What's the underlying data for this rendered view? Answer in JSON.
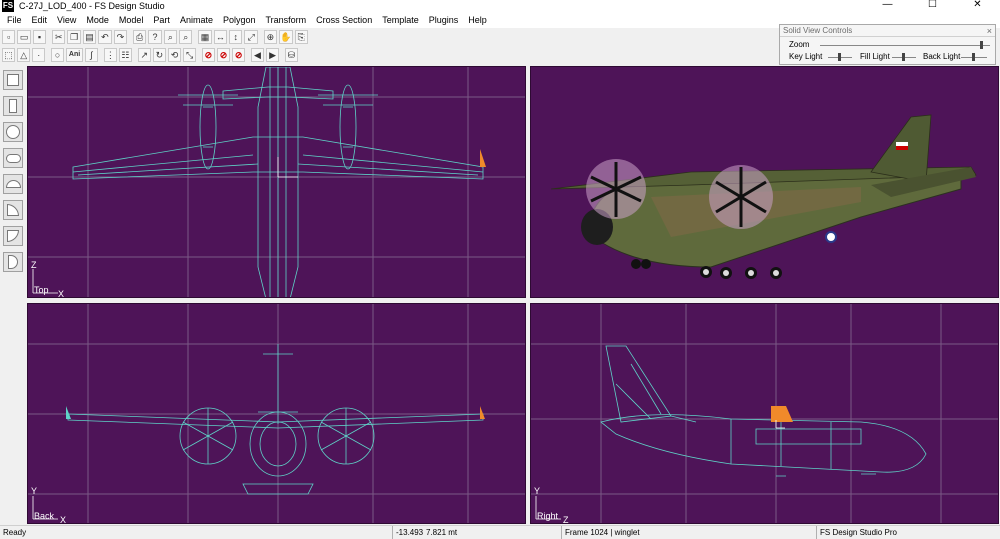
{
  "window": {
    "icon_label": "FS",
    "title": "C-27J_LOD_400 - FS Design Studio",
    "controls": {
      "minimize": "—",
      "maximize": "☐",
      "close": "✕"
    }
  },
  "menu": {
    "items": [
      "File",
      "Edit",
      "View",
      "Mode",
      "Model",
      "Part",
      "Animate",
      "Polygon",
      "Transform",
      "Cross Section",
      "Template",
      "Plugins",
      "Help"
    ]
  },
  "toolbar1": {
    "buttons": [
      "new-file-icon",
      "open-file-icon",
      "save-icon",
      "cut-icon",
      "copy-icon",
      "paste-icon",
      "undo-icon",
      "redo-icon",
      "print-icon",
      "properties-icon",
      "zoom-in-icon",
      "zoom-out-icon",
      "grid-icon",
      "fit-horizontal-icon",
      "fit-vertical-icon",
      "fit-all-icon",
      "move-icon",
      "pan-icon",
      "link-icon"
    ]
  },
  "toolbar2": {
    "buttons": [
      "select-icon",
      "triangle-icon",
      "point-icon",
      "circle-icon",
      "ani-icon",
      "spline-icon",
      "grid-dots-icon",
      "edit-grid-icon",
      "rotate-left-icon",
      "rotate-icon",
      "refresh-icon",
      "scale-icon",
      "stop-icon",
      "stop-2-icon",
      "stop-3-icon",
      "prev-frame-icon",
      "next-frame-icon",
      "bucket-icon"
    ],
    "ani_label": "Ani"
  },
  "solid_view_controls": {
    "title": "Solid View Controls",
    "close_label": "×",
    "zoom_label": "Zoom",
    "key_light_label": "Key Light",
    "fill_light_label": "Fill Light",
    "back_light_label": "Back Light",
    "zoom_level": 0.95,
    "key_light_level": 0.5,
    "fill_light_level": 0.5,
    "back_light_level": 0.5
  },
  "palette": {
    "tools": [
      "box-tool-icon",
      "cylinder-tool-icon",
      "sphere-tool-icon",
      "capsule-tool-icon",
      "dome-tool-icon",
      "bend-tool-icon",
      "cone-tool-icon",
      "half-cylinder-tool-icon"
    ]
  },
  "viewports": {
    "top": {
      "label": "Top",
      "axis_v": "Z",
      "axis_h": "X"
    },
    "perspective": {
      "label": ""
    },
    "back": {
      "label": "Back",
      "axis_v": "Y",
      "axis_h": "X"
    },
    "right": {
      "label": "Right",
      "axis_v": "Y",
      "axis_h": "Z"
    },
    "colors": {
      "background": "#4e1458",
      "wire": "#5fd3c8",
      "grid": "#7a5a86",
      "accent": "#f08a2a"
    }
  },
  "statusbar": {
    "ready": "Ready",
    "coord_x": "-13.493",
    "coord_y": "7.821 mt",
    "frame": "Frame 1024 | winglet",
    "product": "FS Design Studio Pro"
  }
}
